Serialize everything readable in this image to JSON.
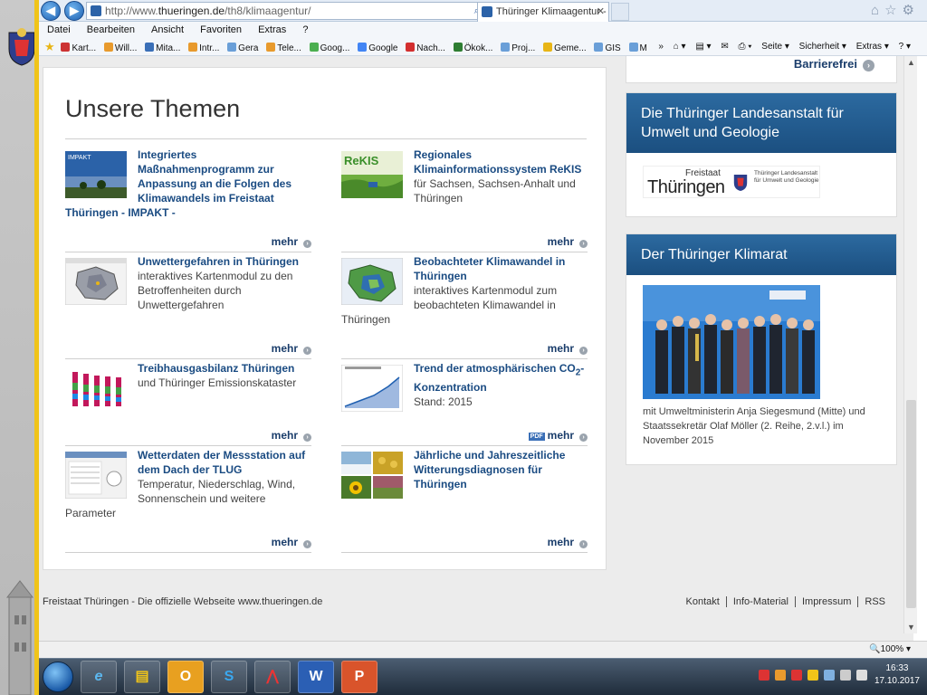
{
  "browser": {
    "url_prefix": "http://www.",
    "url_domain": "thueringen.de",
    "url_path": "/th8/klimaagentur/",
    "url_tools": "⌕ ▾ ⊗ ↻",
    "tab_title": "Thüringer Klimaagentur - S...",
    "tab_close": "✕",
    "back": "◀",
    "forward": "▶",
    "top_right_icons": "⌂☆⚙",
    "menu": [
      "Datei",
      "Bearbeiten",
      "Ansicht",
      "Favoriten",
      "Extras",
      "?"
    ],
    "favorites": [
      "Kart...",
      "Will...",
      "Mita...",
      "Intr...",
      "Gera",
      "Tele...",
      "Goog...",
      "Google",
      "Nach...",
      "Ökok...",
      "Proj...",
      "Geme...",
      "GIS",
      "Mita..."
    ],
    "overflow": "»",
    "commands": [
      "⌂ ▾",
      "▤ ▾",
      "✉",
      "⎙ ▾",
      "Seite ▾",
      "Sicherheit ▾",
      "Extras ▾",
      "? ▾"
    ],
    "zoom": "🔍100%  ▾"
  },
  "page": {
    "barrierefrei": "Barrierefrei",
    "barrierefrei_arrow": "›",
    "themen_title": "Unsere Themen",
    "more_label": "mehr",
    "more_arrow": "›",
    "items": [
      {
        "title": "Integriertes Maßnahmenprogramm zur Anpassung an die Folgen des Klimawandels im Freistaat Thüringen - IMPAKT -",
        "desc": "",
        "thumb_label": "IMPAKT"
      },
      {
        "title": "Regionales Klimainformationssystem ReKIS",
        "desc": "für Sachsen, Sachsen-Anhalt und Thüringen",
        "thumb_label": "ReKIS"
      },
      {
        "title": "Unwettergefahren in Thüringen",
        "desc": "interaktives Kartenmodul zu den Betroffenheiten durch Unwettergefahren"
      },
      {
        "title": "Beobachteter Klimawandel in Thüringen",
        "desc": "interaktives Kartenmodul zum beobachteten Klimawandel in Thüringen"
      },
      {
        "title": "Treibhausgasbilanz Thüringen",
        "desc": "und Thüringer Emissionskataster"
      },
      {
        "title_main": "Trend der atmosphärischen CO",
        "title_sub": "2",
        "title_end": "-Konzentration",
        "desc": "Stand: 2015",
        "pdf_badge": "PDF"
      },
      {
        "title": "Wetterdaten der Messstation auf dem Dach der TLUG",
        "desc": "Temperatur, Niederschlag, Wind, Sonnenschein und weitere Parameter"
      },
      {
        "title": "Jährliche und Jahreszeitliche Witterungsdiagnosen für Thüringen",
        "desc": ""
      }
    ],
    "tlug_box_title": "Die Thüringer Landesanstalt für Umwelt und Geologie",
    "tlug_logo_small": "Freistaat",
    "tlug_logo_big": "Thüringen",
    "tlug_logo_side": "Thüringer Landesanstalt für Umwelt und Geologie",
    "klimarat_title": "Der Thüringer Klimarat",
    "klimarat_caption": "mit Umweltministerin Anja Siegesmund (Mitte) und Staatssekretär Olaf Möller (2. Reihe, 2.v.l.) im November 2015",
    "footer_left": "Freistaat Thüringen - Die offizielle Webseite www.thueringen.de",
    "footer_links": [
      "Kontakt",
      "Info-Material",
      "Impressum",
      "RSS"
    ]
  },
  "taskbar": {
    "time": "16:33",
    "date": "17.10.2017",
    "apps": [
      "ie",
      "explorer",
      "outlook",
      "skype",
      "pdf",
      "word",
      "powerpoint"
    ],
    "app_glyphs": [
      "e",
      "▤",
      "O",
      "S",
      "⋀",
      "W",
      "P"
    ]
  },
  "colors": {
    "accent": "#1a4b82",
    "header_blue": "#1b4f80",
    "highlight": "#f0c419"
  }
}
